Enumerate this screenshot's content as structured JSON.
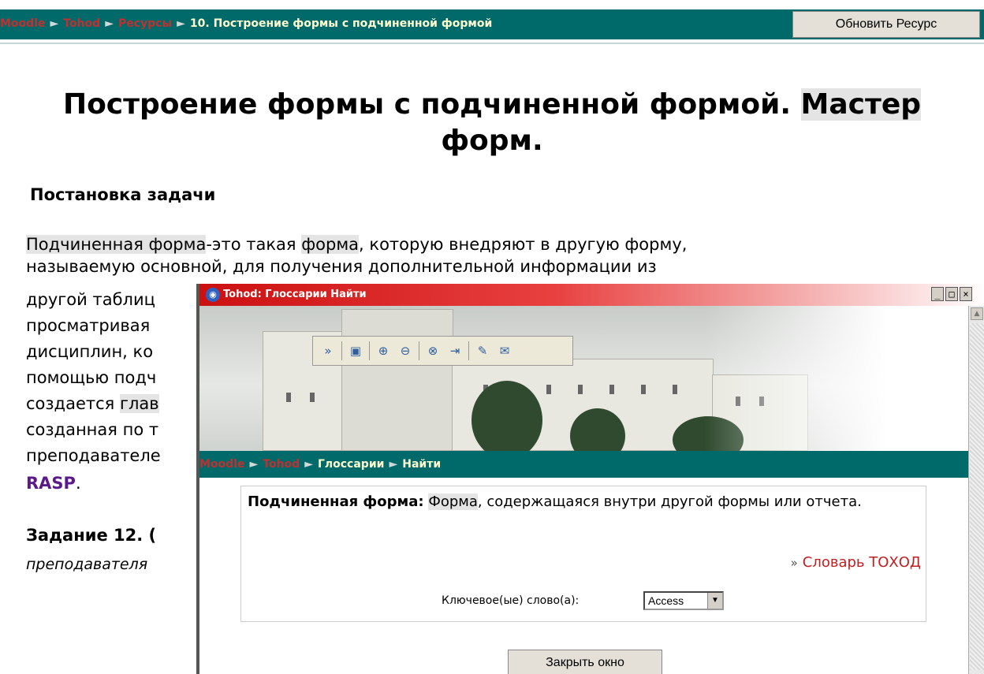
{
  "nav": {
    "crumbs": [
      "Moodle",
      "Tohod",
      "Ресурсы"
    ],
    "current": "10. Построение формы с подчиненной формой",
    "update_button": "Обновить Ресурс"
  },
  "page": {
    "title_main": "Построение формы с подчиненной формой. ",
    "title_highlight": "Мастер",
    "title_line2": "форм.",
    "subtitle": "Постановка задачи",
    "p_hl1": "Подчиненная форма",
    "p_t1": "-это такая ",
    "p_hl2": "форма",
    "p_t2": ", которую внедряют в другую форму,",
    "p_line2": "называемую основной, для получения дополнительной информации из",
    "frag_lines": [
      "другой таблиц",
      "просматривая",
      "дисциплин, ко",
      "помощью подч",
      "создается ",
      "созданная по т",
      "преподавателе"
    ],
    "frag_hl": "глав",
    "rasp": "RASP",
    "rasp_tail": ".",
    "task_title": "Задание 12. (",
    "task_sub": "преподавателя"
  },
  "popup": {
    "title": "Tohod: Глоссарии Найти",
    "controls": [
      "_",
      "□",
      "×"
    ],
    "toolbar_icons": [
      "collapse-icon",
      "save-icon",
      "zoom-in-icon",
      "zoom-out-icon",
      "link-icon",
      "export-icon",
      "edit-icon",
      "email-icon"
    ],
    "crumbs": [
      "Moodle",
      "Tohod",
      "Глоссарии"
    ],
    "current": "Найти",
    "term": "Подчиненная форма:",
    "def_hl": "Форма",
    "def_rest": ", содержащаяся внутри другой формы или отчета.",
    "dict_arrow": "»",
    "dict_link": "Словарь ТОХОД",
    "keywords_label": "Ключевое(ые) слово(а):",
    "keyword_value": "Access",
    "close_button": "Закрыть окно"
  },
  "colors": {
    "nav_bg": "#006a6a",
    "link_red": "#c03030",
    "title_red": "#cc1010",
    "rasp_purple": "#5a1a8a"
  }
}
